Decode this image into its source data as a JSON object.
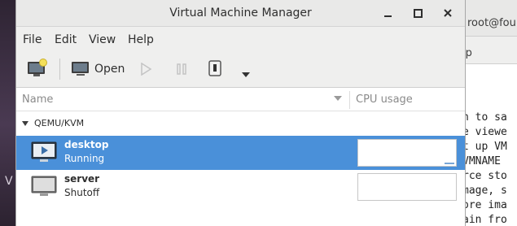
{
  "window": {
    "title": "Virtual Machine Manager",
    "controls": {
      "minimize": "−",
      "maximize": "□",
      "close": "✕"
    }
  },
  "menu": {
    "items": [
      "File",
      "Edit",
      "View",
      "Help"
    ]
  },
  "toolbar": {
    "new_vm_icon": "new-vm-icon",
    "open_label": "Open",
    "run_icon": "play-icon",
    "pause_icon": "pause-icon",
    "shutdown_icon": "power-icon",
    "menu_icon": "chevron-down-icon"
  },
  "table": {
    "columns": {
      "name": "Name",
      "cpu": "CPU usage"
    },
    "group": "QEMU/KVM",
    "vms": [
      {
        "name": "desktop",
        "status": "Running",
        "selected": true
      },
      {
        "name": "server",
        "status": "Shutoff",
        "selected": false
      }
    ]
  },
  "background": {
    "desktop_letter": "V",
    "terminal": {
      "title_fragment": "root@fou",
      "menu_fragment": "lp",
      "lines": [
        "n to sa",
        "e viewe",
        "t up VM",
        "VMNAME",
        "rce sto",
        "mage, s",
        "ore ima",
        "ain fro"
      ]
    }
  },
  "colors": {
    "selection": "#4a90d9",
    "window_chrome": "#efefee"
  }
}
